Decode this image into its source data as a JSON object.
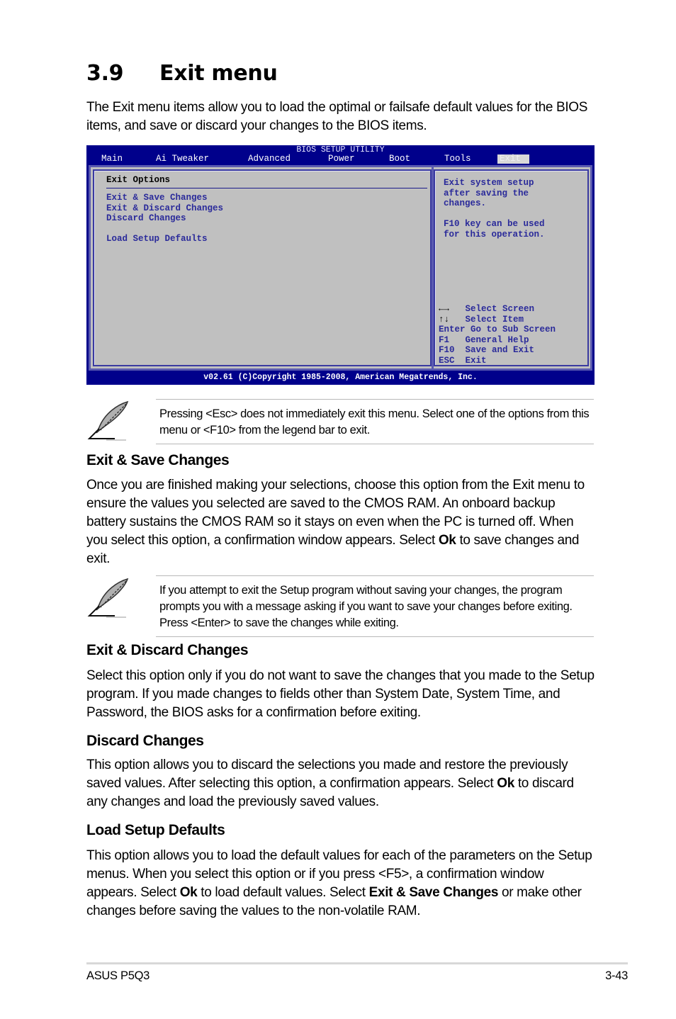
{
  "section": {
    "number": "3.9",
    "title": "Exit menu",
    "intro": "The Exit menu items allow you to load the optimal or failsafe default values for the BIOS items, and save or discard your changes to the BIOS items."
  },
  "bios": {
    "title": "BIOS SETUP UTILITY",
    "tabs": [
      "Main",
      "Ai Tweaker",
      "Advanced",
      "Power",
      "Boot",
      "Tools",
      "Exit"
    ],
    "active_tab": "Exit",
    "panel_heading": "Exit Options",
    "items": [
      "Exit & Save Changes",
      "Exit & Discard Changes",
      "Discard Changes",
      "Load Setup Defaults"
    ],
    "help_lines": [
      "Exit system setup",
      "after saving the",
      "changes.",
      "",
      "F10 key can be used",
      "for this operation."
    ],
    "legend": [
      {
        "key": "←→",
        "icon": "left-right-arrows-icon",
        "action": "Select Screen"
      },
      {
        "key": "↑↓",
        "icon": "up-down-arrows-icon",
        "action": "Select Item"
      },
      {
        "key": "Enter",
        "action": "Go to Sub Screen"
      },
      {
        "key": "F1",
        "action": "General Help"
      },
      {
        "key": "F10",
        "action": "Save and Exit"
      },
      {
        "key": "ESC",
        "action": "Exit"
      }
    ],
    "footer": "v02.61 (C)Copyright 1985-2008, American Megatrends, Inc.",
    "colors": {
      "frame": "#00008b",
      "panel": "#c0c0c0",
      "text": "#2a2a9a"
    }
  },
  "notes": [
    {
      "icon": "feather-note-icon",
      "text": "Pressing <Esc> does not immediately exit this menu. Select one of the options from this menu or <F10> from the legend bar to exit."
    },
    {
      "icon": "feather-note-icon",
      "text": "If you attempt to exit the Setup program without saving your changes, the program prompts you with a message asking if you want to save your changes before exiting. Press <Enter> to save the changes while exiting."
    }
  ],
  "subsections": [
    {
      "title": "Exit & Save Changes",
      "body_parts": [
        "Once you are finished making your selections, choose this option from the Exit menu to ensure the values you selected are saved to the CMOS RAM. An onboard backup battery sustains the CMOS RAM so it stays on even when the PC is turned off. When you select this option, a confirmation window appears. Select ",
        "Ok",
        " to save changes and exit."
      ]
    },
    {
      "title": "Exit & Discard Changes",
      "body_parts": [
        "Select this option only if you do not want to save the changes that you  made to the Setup program. If you made changes to fields other than System Date, System Time, and Password, the BIOS asks for a confirmation before exiting."
      ]
    },
    {
      "title": "Discard Changes",
      "body_parts": [
        "This option allows you to discard the selections you made and restore the previously saved values. After selecting this option, a confirmation appears. Select ",
        "Ok",
        " to discard any changes and load the previously saved values."
      ]
    },
    {
      "title": "Load Setup Defaults",
      "body_parts": [
        "This option allows you to load the default values for each of the parameters on the Setup menus. When you select this option or if you press <F5>, a confirmation window appears. Select ",
        "Ok",
        " to load default values. Select ",
        "Exit & Save Changes",
        " or make other changes before saving the values to the non-volatile RAM."
      ]
    }
  ],
  "footer": {
    "product": "ASUS P5Q3",
    "page": "3-43"
  }
}
